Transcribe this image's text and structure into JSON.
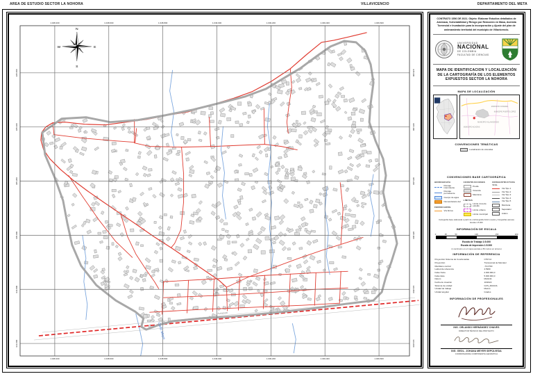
{
  "page": {
    "header_left": "AREA DE ESTUDIO SECTOR LA NOHORA",
    "header_center": "VILLAVICENCIO",
    "header_right": "DEPARTAMENTO DEL META"
  },
  "colors": {
    "road": "#e03b30",
    "stream": "#7ba6de",
    "building_fill": "#dedede",
    "building_stroke": "#7f7f7f",
    "boundary": "#a8a8a8",
    "grid": "#6f6f6f",
    "highway_dash": "#e02525"
  },
  "map": {
    "x_labels": [
      "1.048.400",
      "1.048.600",
      "1.048.800",
      "1.049.000",
      "1.049.200",
      "1.049.400",
      "1.049.600"
    ],
    "y_labels": [
      "945.600",
      "945.400",
      "945.200",
      "945.000",
      "944.800",
      "944.600"
    ],
    "compass": {
      "n": "N",
      "s": "S",
      "e": "E",
      "w": "W"
    },
    "stream_label": "Caño Mayo",
    "highway_label": "Autopista"
  },
  "panel": {
    "contract": "CONTRATO 1556 DE 2021. Objeto: Elaborar Estudios detallados de Amenaza, Vulnerabilidad y Riesgo por Remoción en Masa, Avenida Torrencial e Inundación para la incorporación y Ajuste del plan de ordenamiento territorial del municipio de Villavicencio.",
    "university": {
      "line1": "UNIVERSIDAD",
      "line2": "NACIONAL",
      "line3": "DE COLOMBIA",
      "line4": "FACULTAD DE CIENCIAS"
    },
    "title": "MAPA DE IDENTIFICACION Y LOCALIZACIÓN DE LA CARTOGRAFÍA DE LOS ELEMENTOS EXPUESTOS SECTOR LA NOHORA",
    "sections": {
      "localizacion": "MAPA DE LOCALIZACIÓN",
      "tematicas": "CONVENCIONES TEMÁTICAS",
      "base": "CONVENCIONES BASE CARTOGRÁFICA",
      "escala": "INFORMACIÓN DE ESCALA",
      "referencia": "INFORMACIÓN DE REFERENCIA",
      "profesionales": "INFORMACIÓN DE PROFESIONALES"
    },
    "localizacion_labels": [
      "MUNICIPIO CUMARAL",
      "MUNICIPIO PUERTO LÓPEZ",
      "MUNICIPIO VILLAVICENCIO",
      "MUNICIPIO ACACÍAS"
    ],
    "tematicas_items": [
      {
        "swatch": "rect",
        "fill": "#d9d9d9",
        "stroke": "#555555",
        "label": "Localización de viviendas"
      }
    ],
    "base_columns": [
      {
        "header": "HIDROGRAFÍA",
        "items": [
          {
            "swatch": "line-dash",
            "color": "#4f86d8",
            "label": "Drenaje intermitente"
          },
          {
            "swatch": "line",
            "color": "#4f86d8",
            "label": "Drenaje permanente"
          },
          {
            "swatch": "rect",
            "fill": "#cfe3f7",
            "stroke": "#4f86d8",
            "label": "Cuerpo de agua"
          },
          {
            "swatch": "rect",
            "fill": "#f59b2d",
            "stroke": "#c97a10",
            "label": "Nomenclatura vial"
          }
        ],
        "subheader": "FERROCARRIL",
        "subitems": [
          {
            "swatch": "line",
            "color": "#f59b2d",
            "label": "Vía férrea"
          }
        ]
      },
      {
        "header": "CONSTRUCCIONES",
        "items": [
          {
            "swatch": "rect",
            "fill": "#ffffff",
            "stroke": "#9a9a9a",
            "label": "Predio"
          },
          {
            "swatch": "rect",
            "fill": "#e3e3e3",
            "stroke": "#9a9a9a",
            "label": "Vivienda"
          },
          {
            "swatch": "rect",
            "fill": "#ffffff",
            "stroke": "#8a3b2a",
            "label": "Manzana"
          }
        ],
        "subheader": "LÍMITES",
        "subitems": [
          {
            "swatch": "rect-dash",
            "fill": "#ffffff",
            "stroke": "#9a9a9a",
            "label": "Límite zona de estudio"
          },
          {
            "swatch": "rect-dash",
            "fill": "#ffffff",
            "stroke": "#d34fd3",
            "label": "Límite urbano"
          },
          {
            "swatch": "rect",
            "fill": "#ffe84d",
            "stroke": "#d1b500",
            "label": "Límite municipal"
          }
        ]
      },
      {
        "header": "INFRAESTRUCTURA VIAL",
        "items": [
          {
            "swatch": "line",
            "color": "#e03b30",
            "label": "Vía Tipo 1"
          },
          {
            "swatch": "line",
            "color": "#9a9a9a",
            "label": "Vía Tipo 2"
          },
          {
            "swatch": "line",
            "color": "#c0c0c0",
            "label": "Vía Tipo 3"
          },
          {
            "swatch": "line",
            "color": "#4a4a4a",
            "label": "Vía Tipo 4"
          },
          {
            "swatch": "line",
            "color": "#5b7fa6",
            "label": "Vía Tipo 5"
          },
          {
            "swatch": "rect",
            "fill": "#ffffff",
            "stroke": "#555555",
            "label": "Manzana"
          },
          {
            "swatch": "rect",
            "fill": "#ffffff",
            "stroke": "#555555",
            "label": "Separador"
          },
          {
            "swatch": "rect",
            "fill": "#ffffff",
            "stroke": "#555555",
            "label": "Andén"
          }
        ]
      }
    ],
    "base_note": "Cartografía base elaborada a partir de ortofotografía IGAC (vuelos y fotografías aéreas) Escala 1:5.000",
    "escala": {
      "ticks": [
        "0",
        "25",
        "50",
        "100",
        "150",
        "200 m"
      ],
      "work": "Escala de Trabajo 1:5.000",
      "print": "Escala de Impresión 1:5.000",
      "note": "(1 centímetro en el mapa equivale a 50 metros en terreno)"
    },
    "referencia_rows": [
      [
        "Proyección Sistema de Coordenadas",
        "CTM 12"
      ],
      [
        "Proyección",
        "Transversal de Mercator"
      ],
      [
        "Meridiano central",
        "-73.0790"
      ],
      [
        "Latitud de referencia",
        "4.5960"
      ],
      [
        "Falso Norte",
        "2.000.000,0"
      ],
      [
        "Falso Este",
        "5.000.000,0"
      ],
      [
        "Datum",
        "MAGNA"
      ],
      [
        "Fecha de creación",
        "10/2022"
      ],
      [
        "Sistema de unidad",
        "GCS_MAGNA"
      ],
      [
        "Unidad de trabajo",
        "Metros"
      ],
      [
        "Unidad angular",
        "Grados"
      ]
    ],
    "profesionales": [
      {
        "name": "ING. ORLANDO HERNÁNDEZ CHAVES",
        "role": "DIRECTOR TÉCNICO DEL PROYECTO"
      },
      {
        "name": "ING. GEOL. JOHANA MEYER SEPÚLVEDA",
        "role": "COORDINADORA COMPONENTE GEOMÁTICA"
      }
    ]
  }
}
